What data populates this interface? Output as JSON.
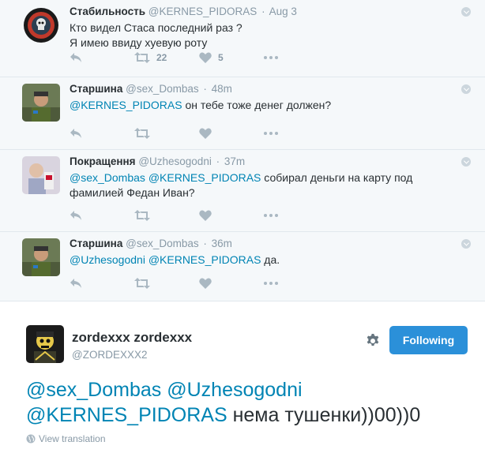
{
  "thread": [
    {
      "fullname": "Стабильность",
      "username": "@KERNES_PIDORAS",
      "time": "Aug 3",
      "line1": "Кто видел Стаса последний раз ?",
      "line2": "Я имею ввиду хуевую роту",
      "retweets": "22",
      "likes": "5"
    },
    {
      "fullname": "Старшина",
      "username": "@sex_Dombas",
      "time": "48m",
      "mention1": "@KERNES_PIDORAS",
      "text": " он тебе тоже денег должен?"
    },
    {
      "fullname": "Покращення",
      "username": "@Uzhesogodni",
      "time": "37m",
      "mention1": "@sex_Dombas",
      "mention2": "@KERNES_PIDORAS",
      "text": " собирал деньги на карту под фамилией Федан Иван?"
    },
    {
      "fullname": "Старшина",
      "username": "@sex_Dombas",
      "time": "36m",
      "mention1": "@Uzhesogodni",
      "mention2": "@KERNES_PIDORAS",
      "text": " да."
    }
  ],
  "main": {
    "fullname": "zordexxx zordexxx",
    "username": "@ZORDEXXX2",
    "follow_label": "Following",
    "mention1": "@sex_Dombas",
    "mention2": "@Uzhesogodni",
    "mention3": "@KERNES_PIDORAS",
    "text": " нема тушенки))00))0",
    "translate_label": "View translation"
  },
  "colors": {
    "link": "#0084b4",
    "follow_button": "#2b90d9",
    "muted": "#8899a6"
  },
  "icons": [
    "reply-icon",
    "retweet-icon",
    "like-icon",
    "more-icon",
    "gear-icon",
    "globe-icon",
    "caret-icon"
  ]
}
